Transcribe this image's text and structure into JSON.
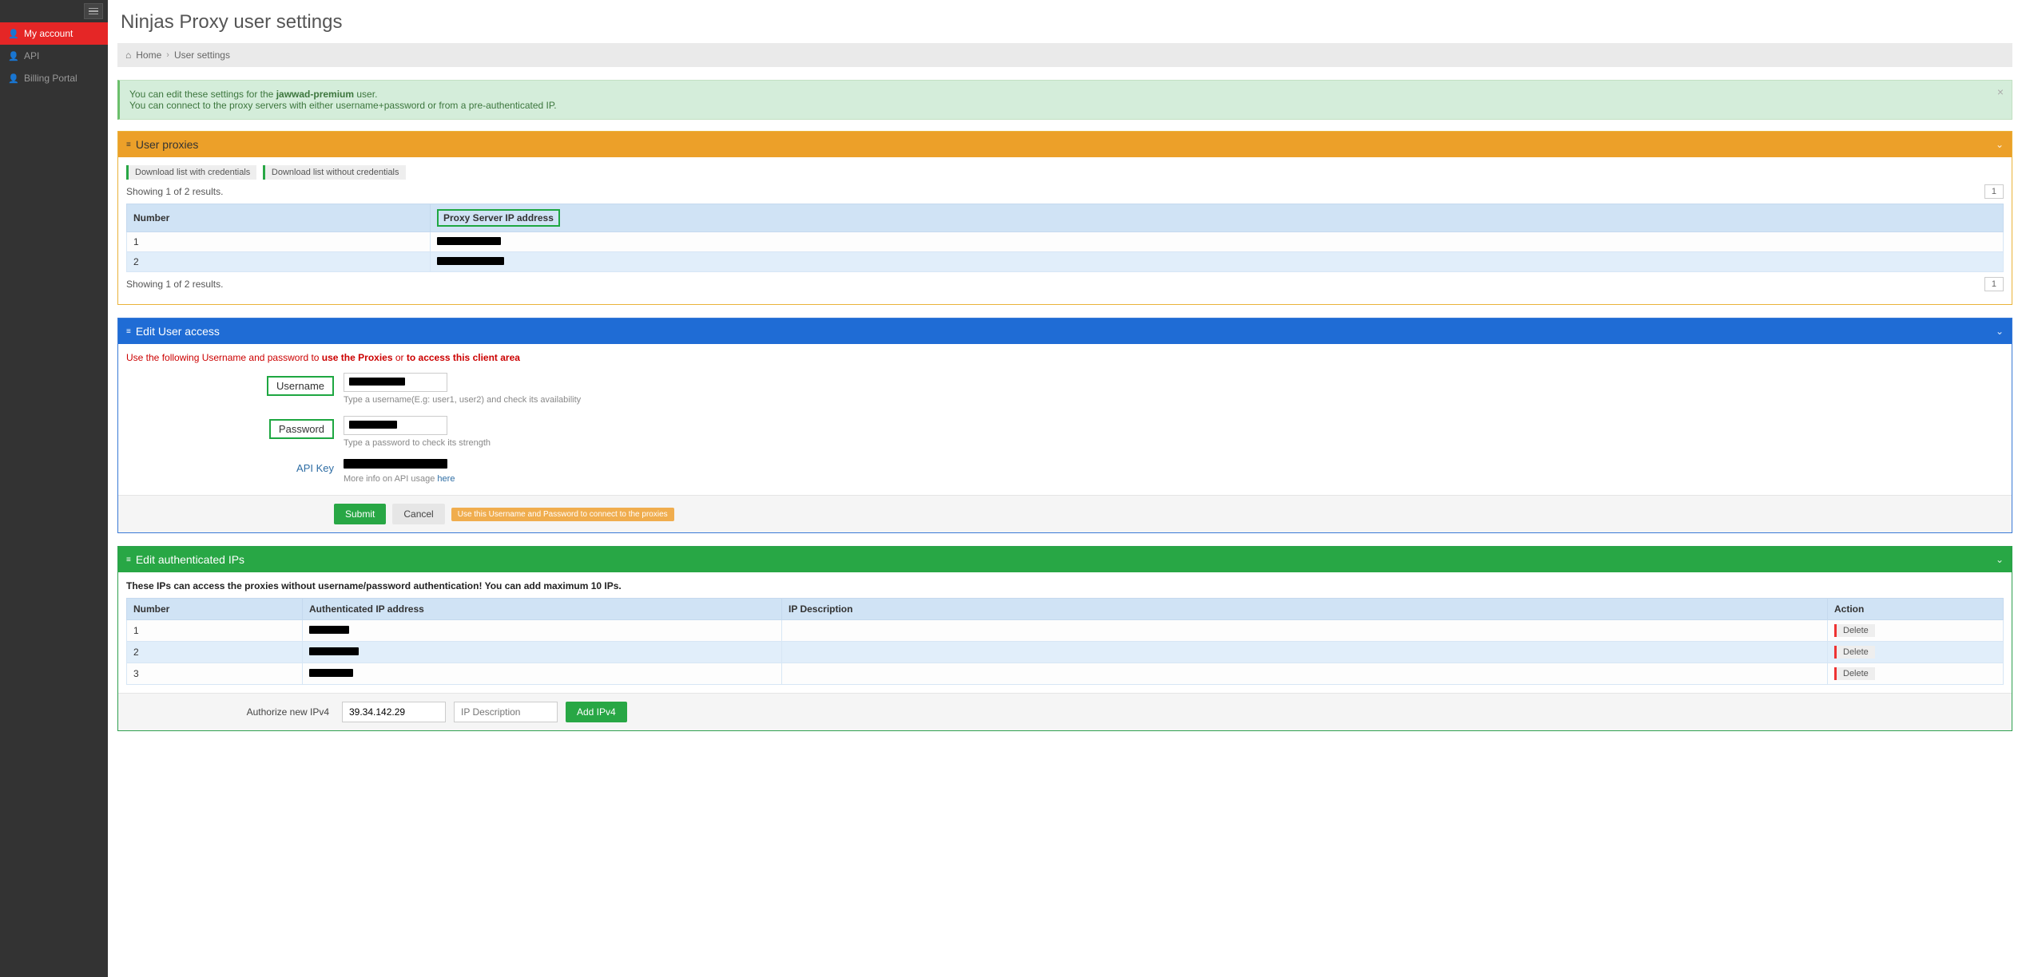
{
  "sidebar": {
    "items": [
      {
        "label": "My account",
        "active": true
      },
      {
        "label": "API",
        "active": false
      },
      {
        "label": "Billing Portal",
        "active": false
      }
    ]
  },
  "page": {
    "title": "Ninjas Proxy user settings"
  },
  "breadcrumb": {
    "home": "Home",
    "sep": "›",
    "current": "User settings"
  },
  "alert": {
    "line1_pre": "You can edit these settings for the ",
    "line1_strong": "jawwad-premium",
    "line1_post": " user.",
    "line2": "You can connect to the proxy servers with either username+password or from a pre-authenticated IP."
  },
  "proxies": {
    "header": "User proxies",
    "dl_with": "Download list with credentials",
    "dl_without": "Download list without credentials",
    "showing": "Showing 1 of 2 results.",
    "page_num": "1",
    "col_number": "Number",
    "col_ip": "Proxy Server IP address",
    "rows": [
      {
        "num": "1",
        "ip": "███████████"
      },
      {
        "num": "2",
        "ip": "███████████"
      }
    ]
  },
  "access": {
    "header": "Edit User access",
    "instr_pre": "Use the following Username and password to ",
    "instr_link1": "use the Proxies",
    "instr_mid": " or ",
    "instr_link2": "to access this client area",
    "username_label": "Username",
    "username_help": "Type a username(E.g: user1, user2) and check its availability",
    "password_label": "Password",
    "password_help": "Type a password to check its strength",
    "apikey_label": "API Key",
    "apikey_help_pre": "More info on API usage ",
    "apikey_help_link": "here",
    "submit": "Submit",
    "cancel": "Cancel",
    "note": "Use this Username and Password to connect to the proxies"
  },
  "ips": {
    "header": "Edit authenticated IPs",
    "note": "These IPs can access the proxies without username/password authentication! You can add maximum 10 IPs.",
    "col_number": "Number",
    "col_ip": "Authenticated IP address",
    "col_desc": "IP Description",
    "col_action": "Action",
    "delete": "Delete",
    "rows": [
      {
        "num": "1",
        "ip": "██████",
        "desc": ""
      },
      {
        "num": "2",
        "ip": "███████",
        "desc": ""
      },
      {
        "num": "3",
        "ip": "██████",
        "desc": ""
      }
    ],
    "add_label": "Authorize new IPv4",
    "add_ip_value": "39.34.142.29",
    "add_desc_placeholder": "IP Description",
    "add_btn": "Add IPv4"
  }
}
